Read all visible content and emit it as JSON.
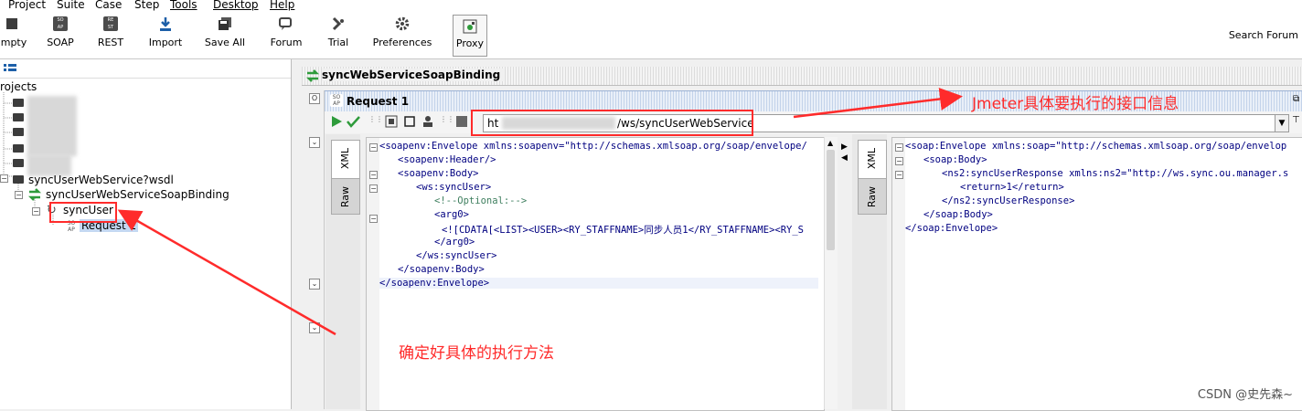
{
  "menu": [
    "Project",
    "Suite",
    "Case",
    "Step",
    "Tools",
    "Desktop",
    "Help"
  ],
  "toolbar": {
    "buttons": [
      "mpty",
      "SOAP",
      "REST",
      "Import",
      "Save All",
      "Forum",
      "Trial",
      "Preferences",
      "Proxy"
    ],
    "search_forum": "Search Forum"
  },
  "tree": {
    "root": "rojects",
    "wsdl": "syncUserWebService?wsdl",
    "binding": "syncUserWebServiceSoapBinding",
    "operation": "syncUser",
    "request": "Request 1"
  },
  "binding_title": "syncWebServiceSoapBinding",
  "request_title": "Request 1",
  "endpoint": {
    "prefix": "ht",
    "suffix": "/ws/syncUserWebService"
  },
  "tabs": {
    "xml": "XML",
    "raw": "Raw"
  },
  "request_xml": [
    "<soapenv:Envelope xmlns:soapenv=\"http://schemas.xmlsoap.org/soap/envelope/",
    "<soapenv:Header/>",
    "<soapenv:Body>",
    "<ws:syncUser>",
    "<!--Optional:-->",
    "<arg0>",
    "<![CDATA[<LIST><USER><RY_STAFFNAME>同步人员1</RY_STAFFNAME><RY_S",
    "</arg0>",
    "</ws:syncUser>",
    "</soapenv:Body>",
    "</soapenv:Envelope>"
  ],
  "response_xml": [
    "<soap:Envelope xmlns:soap=\"http://schemas.xmlsoap.org/soap/envelop",
    "<soap:Body>",
    "<ns2:syncUserResponse xmlns:ns2=\"http://ws.sync.ou.manager.s",
    "<return>1</return>",
    "</ns2:syncUserResponse>",
    "</soap:Body>",
    "</soap:Envelope>"
  ],
  "annotations": {
    "top": "Jmeter具体要执行的接口信息",
    "bottom": "确定好具体的执行方法"
  },
  "watermark": "CSDN @史先森~",
  "colors": {
    "annotation": "#ff2b2b",
    "selection": "#c4d8f2"
  }
}
